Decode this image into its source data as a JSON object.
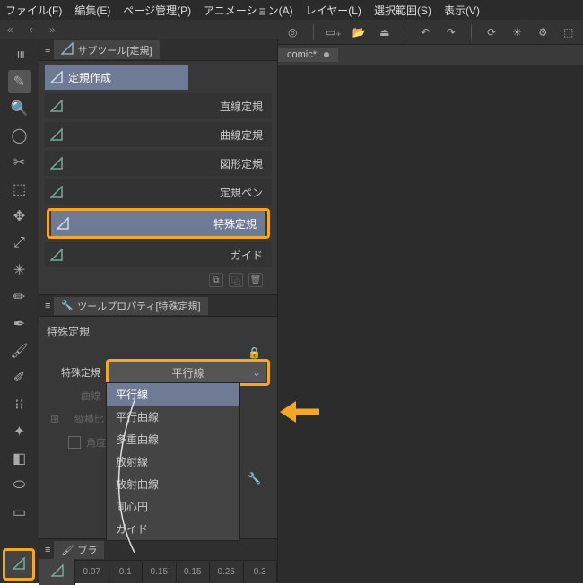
{
  "menu": {
    "file": "ファイル(F)",
    "edit": "編集(E)",
    "page": "ページ管理(P)",
    "anim": "アニメーション(A)",
    "layer": "レイヤー(L)",
    "select": "選択範囲(S)",
    "view": "表示(V)"
  },
  "nav": {
    "back": "«",
    "fwd": "‹",
    "next": "»"
  },
  "sidepanel": {
    "subtool_tab": "サブツール[定規]",
    "items": {
      "create": "定規作成",
      "line": "直線定規",
      "curve": "曲線定規",
      "shape": "図形定規",
      "pen": "定規ペン",
      "special": "特殊定規",
      "guide": "ガイド"
    }
  },
  "prop": {
    "tab": "ツールプロパティ[特殊定規]",
    "title": "特殊定規",
    "label_special": "特殊定規",
    "dropdown_value": "平行線",
    "options": {
      "parallel": "平行線",
      "parallel_curve": "平行曲線",
      "multi_curve": "多重曲線",
      "radial": "放射線",
      "radial_curve": "放射曲線",
      "concentric": "同心円",
      "guide": "ガイド"
    },
    "label_curve": "曲線",
    "label_ratio": "縦横比",
    "label_angle": "角度の"
  },
  "brush": {
    "tab": "ブラ"
  },
  "sizes": [
    "0.07",
    "0.1",
    "0.15",
    "0.15",
    "0.25",
    "0.3"
  ],
  "doc": {
    "name": "comic*"
  }
}
